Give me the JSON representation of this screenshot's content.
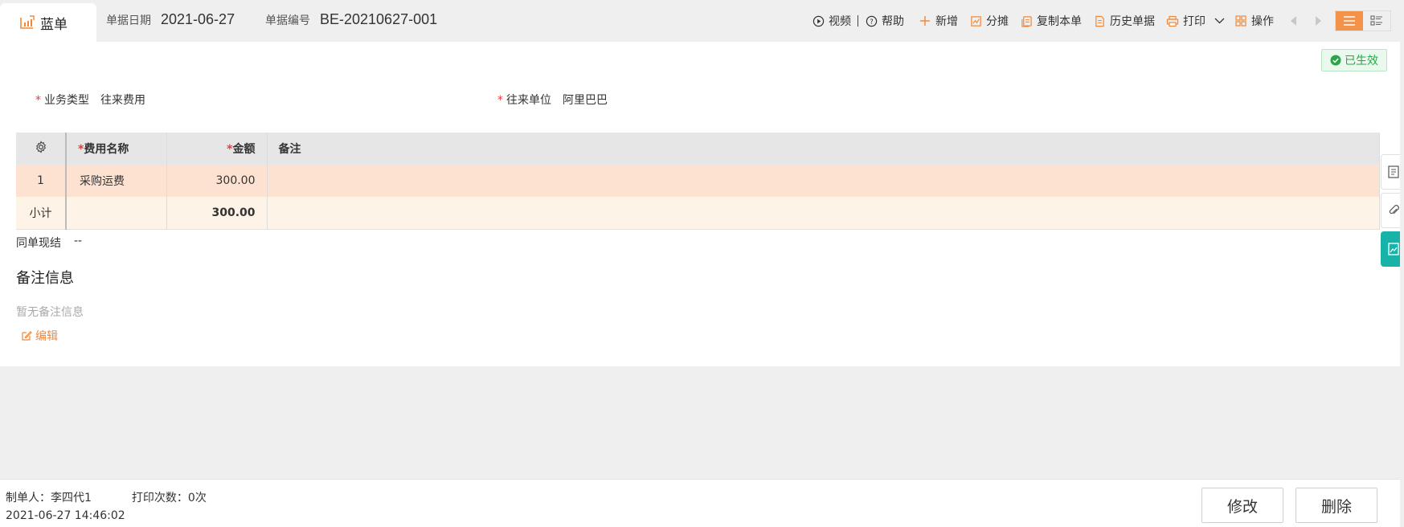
{
  "tab": {
    "label": "蓝单"
  },
  "header": {
    "date_label": "单据日期",
    "date_value": "2021-06-27",
    "number_label": "单据编号",
    "number_value": "BE-20210627-001"
  },
  "toolbar": {
    "video": "视频",
    "help": "帮助",
    "add": "新增",
    "split": "分摊",
    "copy": "复制本单",
    "history": "历史单据",
    "print": "打印",
    "operate": "操作"
  },
  "status": {
    "label": "已生效",
    "color": "#2aa549"
  },
  "fields": {
    "business_type_label": "业务类型",
    "business_type_value": "往来费用",
    "partner_label": "往来单位",
    "partner_value": "阿里巴巴"
  },
  "table": {
    "headers": {
      "name": "费用名称",
      "amount": "金额",
      "note": "备注"
    },
    "rows": [
      {
        "index": "1",
        "name": "采购运费",
        "amount": "300.00",
        "note": ""
      }
    ],
    "subtotal": {
      "label": "小计",
      "amount": "300.00"
    }
  },
  "settlement": {
    "label": "同单现结",
    "value": "--"
  },
  "remarks": {
    "title": "备注信息",
    "empty": "暂无备注信息",
    "edit": "编辑"
  },
  "footer": {
    "creator": "制单人：李四代1",
    "print_count": "打印次数：0次",
    "timestamp": "2021-06-27 14:46:02",
    "modify": "修改",
    "delete": "删除"
  },
  "colors": {
    "accent": "#f0883a",
    "row_highlight": "#fde2d2",
    "subtotal_bg": "#fdf3e7",
    "side_tab": "#17b3a8"
  }
}
